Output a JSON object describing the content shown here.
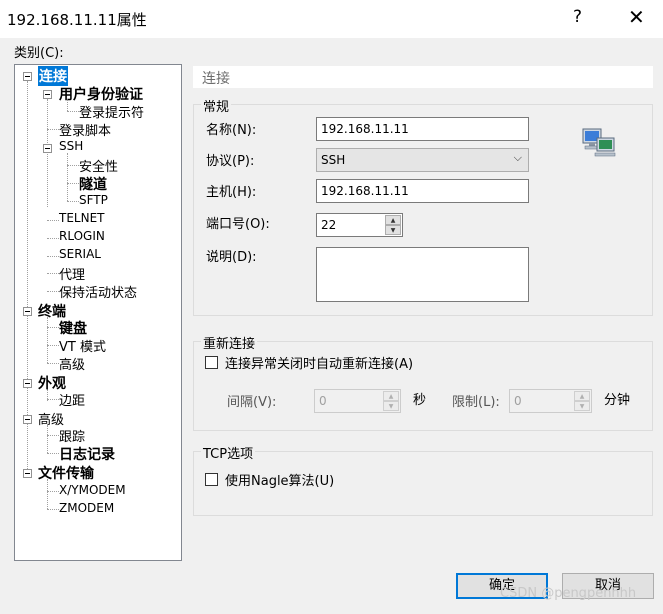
{
  "window": {
    "title": "192.168.11.11属性",
    "help_label": "?",
    "close_label": "✕"
  },
  "category_label": "类别(C):",
  "tree": {
    "connection": "连接",
    "auth": "用户身份验证",
    "login_prompt": "登录提示符",
    "login_script": "登录脚本",
    "ssh": "SSH",
    "security": "安全性",
    "tunnel": "隧道",
    "sftp": "SFTP",
    "telnet": "TELNET",
    "rlogin": "RLOGIN",
    "serial": "SERIAL",
    "proxy": "代理",
    "keepalive": "保持活动状态",
    "terminal": "终端",
    "keyboard": "键盘",
    "vt_mode": "VT 模式",
    "advanced": "高级",
    "appearance": "外观",
    "margin": "边距",
    "advanced2": "高级",
    "trace": "跟踪",
    "log": "日志记录",
    "file_transfer": "文件传输",
    "xymodem": "X/YMODEM",
    "zmodem": "ZMODEM"
  },
  "panel": {
    "header": "连接"
  },
  "general": {
    "title": "常规",
    "name_label": "名称(N):",
    "name_value": "192.168.11.11",
    "protocol_label": "协议(P):",
    "protocol_value": "SSH",
    "host_label": "主机(H):",
    "host_value": "192.168.11.11",
    "port_label": "端口号(O):",
    "port_value": "22",
    "desc_label": "说明(D):",
    "desc_value": ""
  },
  "reconnect": {
    "title": "重新连接",
    "auto_label": "连接异常关闭时自动重新连接(A)",
    "interval_label": "间隔(V):",
    "interval_value": "0",
    "seconds_label": "秒",
    "limit_label": "限制(L):",
    "limit_value": "0",
    "minutes_label": "分钟"
  },
  "tcp": {
    "title": "TCP选项",
    "nagle_label": "使用Nagle算法(U)"
  },
  "buttons": {
    "ok": "确定",
    "cancel": "取消"
  },
  "watermark": "CSDN @pengpenhhh"
}
